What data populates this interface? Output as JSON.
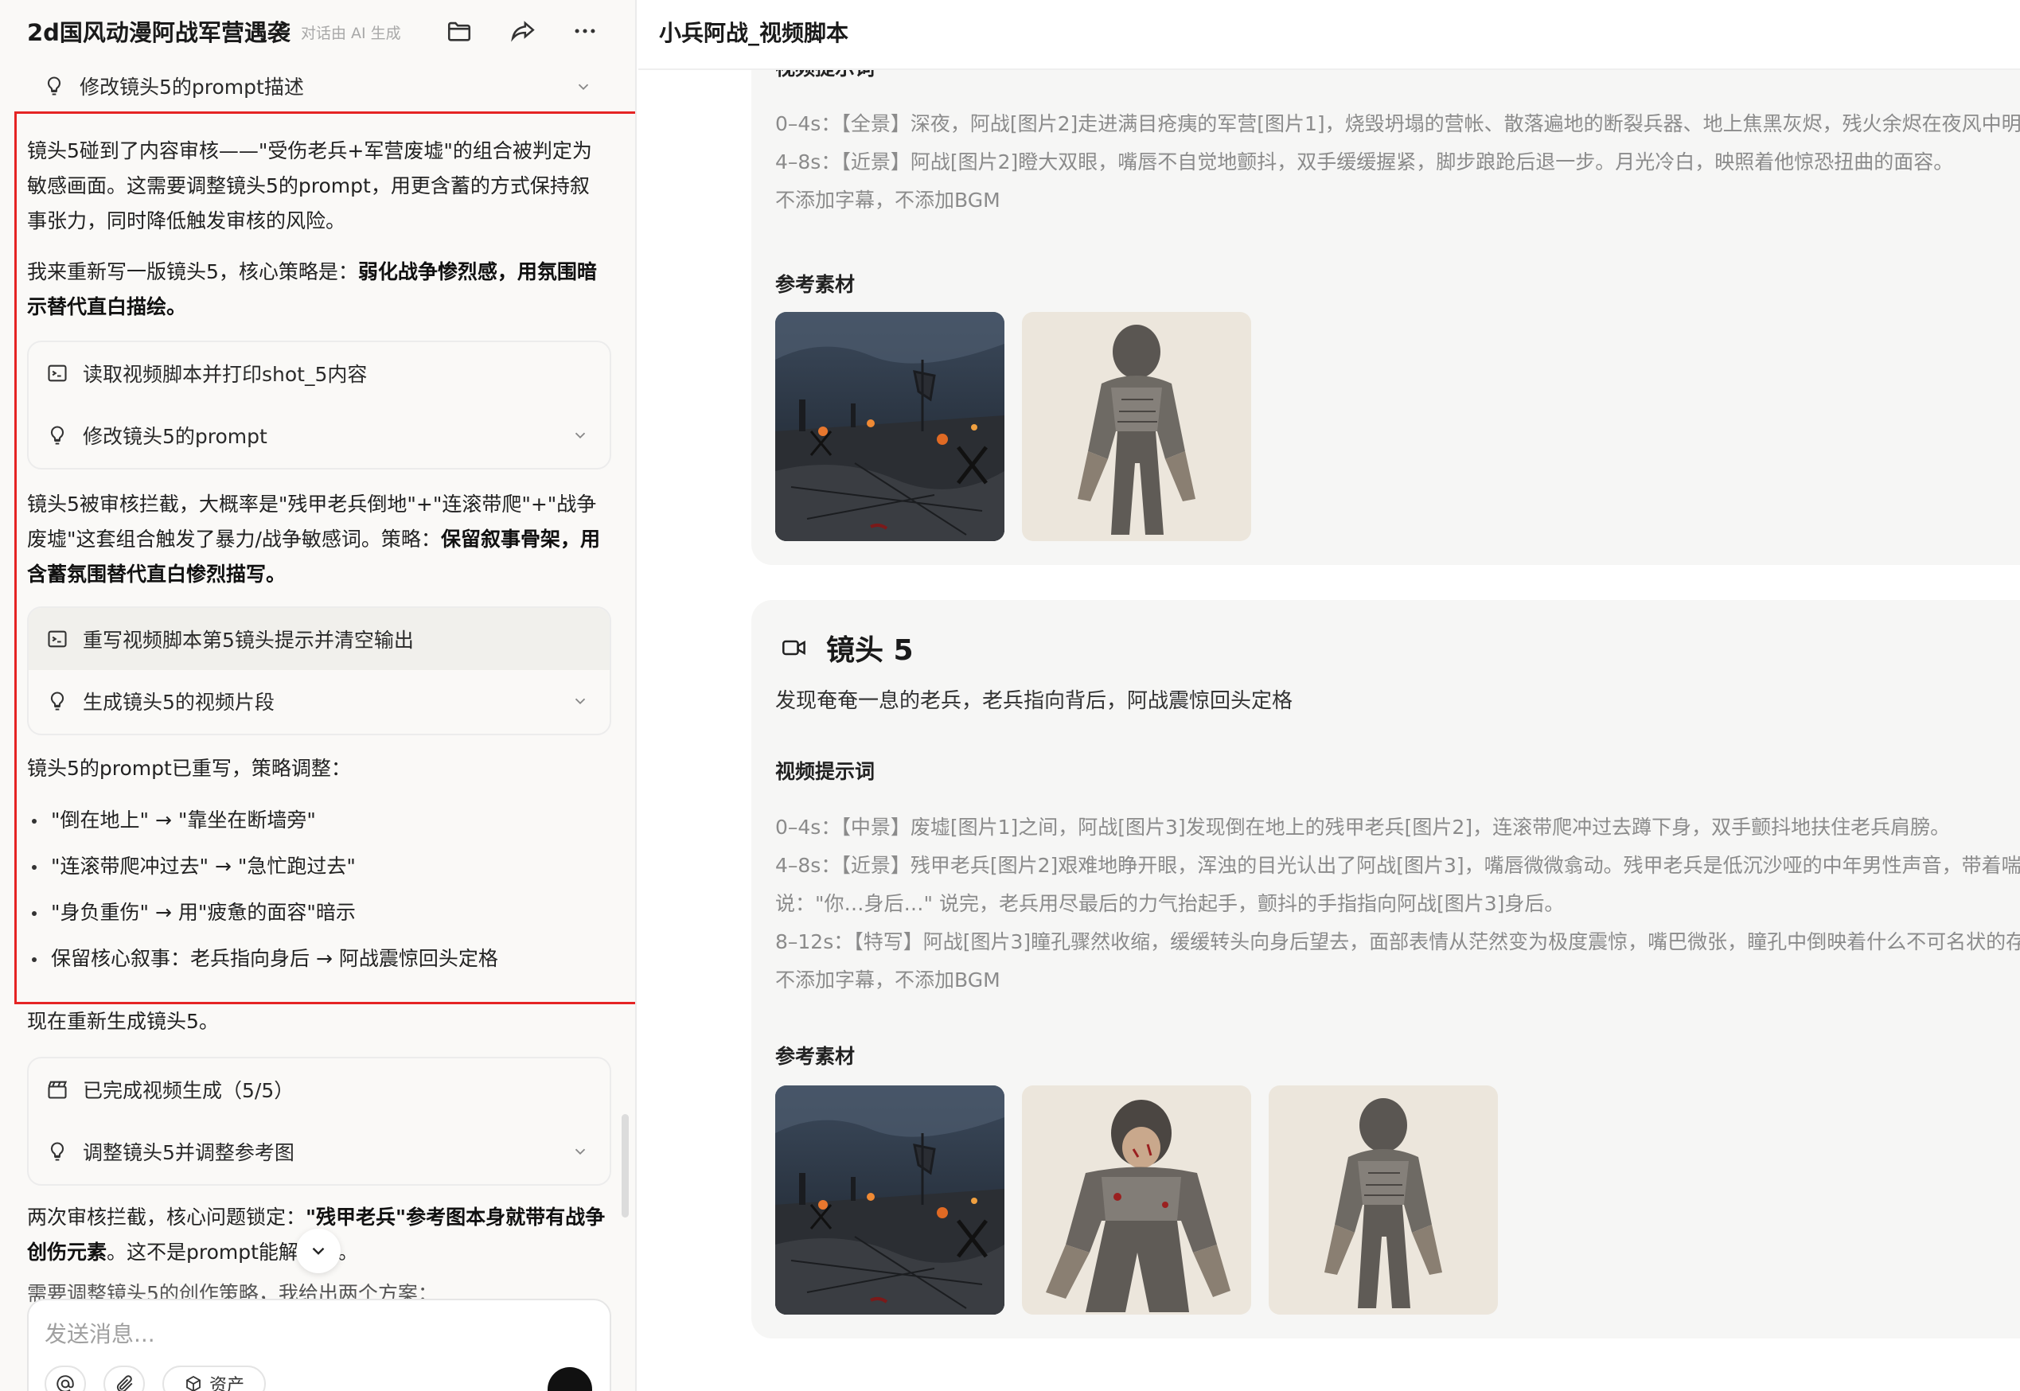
{
  "left_panel": {
    "title": "2d国风动漫阿战军营遇袭",
    "ai_note": "对话由 AI 生成",
    "top_step": "修改镜头5的prompt描述",
    "para1": "镜头5碰到了内容审核——\"受伤老兵+军营废墟\"的组合被判定为敏感画面。这需要调整镜头5的prompt，用更含蓄的方式保持叙事张力，同时降低触发审核的风险。",
    "para2_prefix": "我来重新写一版镜头5，核心策略是：",
    "para2_bold": "弱化战争惨烈感，用氛围暗示替代直白描绘。",
    "card1": {
      "row1": "读取视频脚本并打印shot_5内容",
      "row2": "修改镜头5的prompt"
    },
    "para3_prefix": "镜头5被审核拦截，大概率是\"残甲老兵倒地\"+\"连滚带爬\"+\"战争废墟\"这套组合触发了暴力/战争敏感词。策略：",
    "para3_bold": "保留叙事骨架，用含蓄氛围替代直白惨烈描写。",
    "card2": {
      "row1": "重写视频脚本第5镜头提示并清空输出",
      "row2": "生成镜头5的视频片段"
    },
    "para4": "镜头5的prompt已重写，策略调整：",
    "bullets": [
      "\"倒在地上\" → \"靠坐在断墙旁\"",
      "\"连滚带爬冲过去\" → \"急忙跑过去\"",
      "\"身负重伤\" → 用\"疲惫的面容\"暗示",
      "保留核心叙事：老兵指向身后 → 阿战震惊回头定格"
    ],
    "para5": "现在重新生成镜头5。",
    "card3": {
      "row1": "已完成视频生成（5/5）",
      "row2": "调整镜头5并调整参考图"
    },
    "para6_prefix": "两次审核拦截，核心问题锁定：",
    "para6_bold": "\"残甲老兵\"参考图本身就带有战争创伤元素",
    "para6_suffix": "。这不是prompt能解决的。",
    "para7": "需要调整镜头5的创作策略，我给出两个方案：",
    "composer_placeholder": "发送消息...",
    "tool_label": "资产"
  },
  "right_panel": {
    "doc_title": "小兵阿战_视频脚本",
    "shot4": {
      "prompt_label": "视频提示词",
      "lines": [
        "0–4s：【全景】深夜，阿战[图片2]走进满目疮痍的军营[图片1]，烧毁坍塌的营帐、散落遍地的断裂兵器、地上焦黑灰烬，残火余烬在夜风中明灭",
        "4–8s：【近景】阿战[图片2]瞪大双眼，嘴唇不自觉地颤抖，双手缓缓握紧，脚步踉跄后退一步。月光冷白，映照着他惊恐扭曲的面容。",
        "不添加字幕，不添加BGM"
      ],
      "ref_label": "参考素材"
    },
    "shot5": {
      "title": "镜头 5",
      "desc": "发现奄奄一息的老兵，老兵指向背后，阿战震惊回头定格",
      "prompt_label": "视频提示词",
      "lines": [
        "0–4s：【中景】废墟[图片1]之间，阿战[图片3]发现倒在地上的残甲老兵[图片2]，连滚带爬冲过去蹲下身，双手颤抖地扶住老兵肩膀。",
        "4–8s：【近景】残甲老兵[图片2]艰难地睁开眼，浑浊的目光认出了阿战[图片3]，嘴唇微微翕动。残甲老兵是低沉沙哑的中年男性声音，带着喘息",
        "说：\"你…身后…\" 说完，老兵用尽最后的力气抬起手，颤抖的手指指向阿战[图片3]身后。",
        "8–12s：【特写】阿战[图片3]瞳孔骤然收缩，缓缓转头向身后望去，面部表情从茫然变为极度震惊，嘴巴微张，瞳孔中倒映着什么不可名状的存在",
        "不添加字幕，不添加BGM"
      ],
      "ref_label": "参考素材"
    }
  }
}
